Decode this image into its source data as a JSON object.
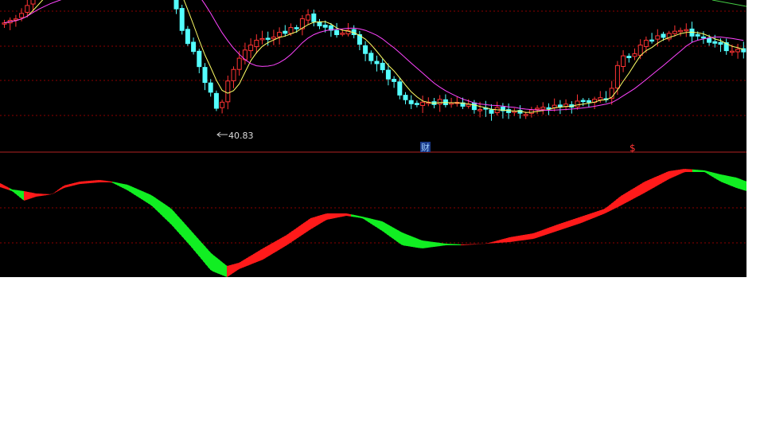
{
  "chart_data": [
    {
      "type": "candlestick",
      "annotations": {
        "low_price_label": "40.83",
        "marker_cai": "财",
        "marker_dollar": "$"
      },
      "colors": {
        "up": "#ff3333",
        "down": "#54ffff",
        "ma_short": "#ffff66",
        "ma_long": "#ff44ff",
        "ma_long2": "#44cc44",
        "grid": "#8b0000",
        "background": "#000000"
      }
    },
    {
      "type": "area",
      "colors": {
        "positive": "#ff1a1a",
        "negative": "#11ee22"
      }
    }
  ]
}
